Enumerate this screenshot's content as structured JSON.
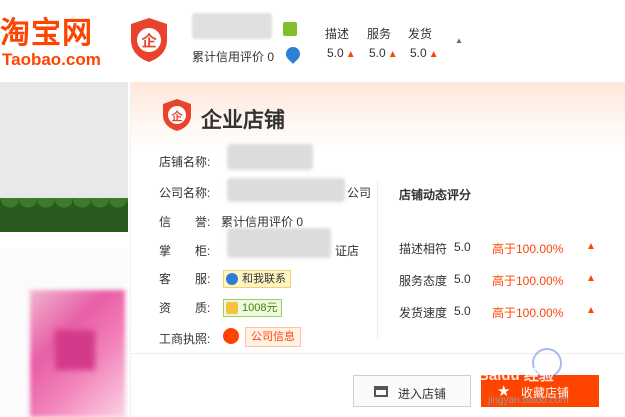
{
  "header": {
    "logo_cn": "淘宝网",
    "logo_en": "Taobao.com",
    "credit_label": "累计信用评价 0",
    "dsr": [
      {
        "label": "描述",
        "score": "5.0"
      },
      {
        "label": "服务",
        "score": "5.0"
      },
      {
        "label": "发货",
        "score": "5.0"
      }
    ]
  },
  "panel": {
    "title": "企业店铺",
    "shop_name_label": "店铺名称:",
    "company_name_label": "公司名称:",
    "company_name_suffix": "公司",
    "credit_label": "信　　誉:",
    "credit_value": "累计信用评价 0",
    "owner_label": "掌　　柜:",
    "owner_suffix": "证店",
    "service_label": "客　　服:",
    "contact_button": "和我联系",
    "deposit_label": "资　　质:",
    "deposit_value": "1008元",
    "license_label": "工商执照:",
    "company_info_button": "公司信息"
  },
  "dynamic_rating": {
    "title": "店铺动态评分",
    "rows": [
      {
        "name": "描述相符",
        "score": "5.0",
        "compare": "高于100.00%"
      },
      {
        "name": "服务态度",
        "score": "5.0",
        "compare": "高于100.00%"
      },
      {
        "name": "发货速度",
        "score": "5.0",
        "compare": "高于100.00%"
      }
    ]
  },
  "actions": {
    "enter_shop": "进入店铺",
    "favorite_shop": "收藏店铺"
  },
  "watermark": {
    "cn": "Baidu 经验",
    "en": "jingyan.baidu.com"
  },
  "colors": {
    "brand": "#ff4400",
    "rating_up": "#ff4400"
  },
  "icons": {
    "enterprise_badge": "shield-qi-icon",
    "up_arrow": "up-arrow-icon",
    "store": "store-icon",
    "star": "star-icon"
  }
}
